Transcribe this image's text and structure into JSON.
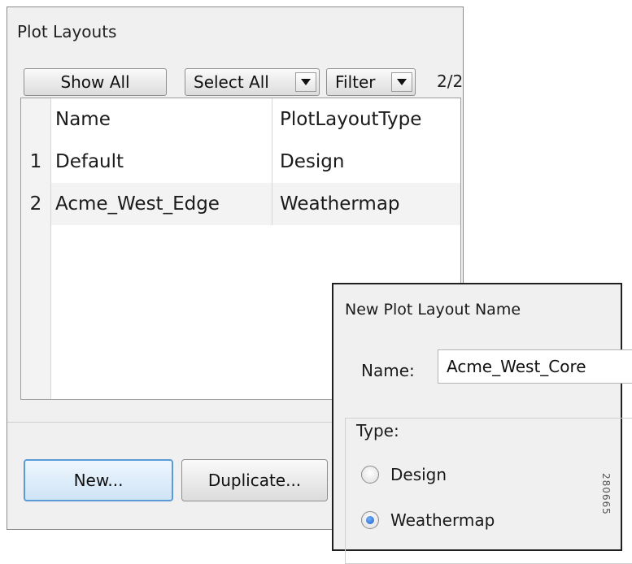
{
  "panel": {
    "title": "Plot Layouts",
    "toolbar": {
      "show_all": "Show All",
      "select_all": "Select All",
      "filter": "Filter",
      "count": "2/2"
    },
    "table": {
      "columns": [
        "Name",
        "PlotLayoutType"
      ],
      "rows": [
        {
          "index": "1",
          "name": "Default",
          "type": "Design"
        },
        {
          "index": "2",
          "name": "Acme_West_Edge",
          "type": "Weathermap"
        }
      ]
    },
    "buttons": {
      "new": "New...",
      "duplicate": "Duplicate..."
    }
  },
  "dialog": {
    "title": "New Plot Layout Name",
    "name_label": "Name:",
    "name_value": "Acme_West_Core",
    "type_label": "Type:",
    "options": [
      "Design",
      "Weathermap"
    ],
    "selected": "Weathermap"
  },
  "watermark": "280665",
  "colors": {
    "panel_bg": "#f0f0f0",
    "new_button_border": "#5b9bd5",
    "radio_selected": "#1f5fbf"
  }
}
